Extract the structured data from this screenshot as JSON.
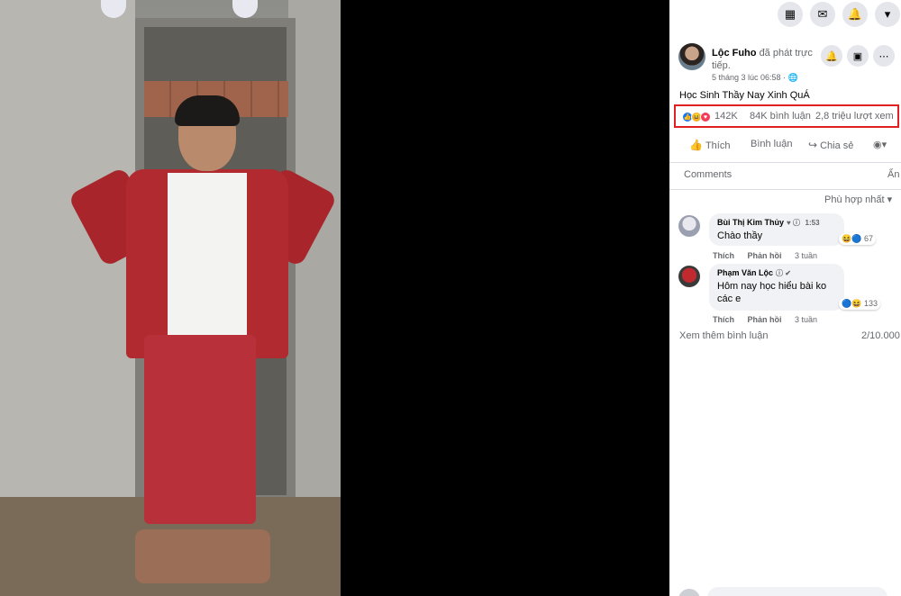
{
  "topbar": {
    "menu_icon": "grid-icon",
    "messenger_icon": "messenger-icon",
    "notification_icon": "bell-icon",
    "account_icon": "caret-down-icon"
  },
  "post": {
    "author": "Lộc Fuho",
    "live_text": "đã phát trực tiếp.",
    "time": "5 tháng 3 lúc 06:58 ·",
    "caption": "Học Sinh Thầy Nay Xinh QuÁ",
    "reactions_count": "142K",
    "comments_count": "84K bình luận",
    "views_count": "2,8 triệu lượt xem",
    "reaction_colors": {
      "like": "#1877f2",
      "haha": "#f7b125",
      "love": "#f33e58"
    },
    "highlight_color": "#e02020"
  },
  "actions": {
    "like": "Thích",
    "comment": "Bình luận",
    "share": "Chia sẻ"
  },
  "comments_section": {
    "tab_comments": "Comments",
    "tab_hide": "Ẩn",
    "sort": "Phù hợp nhất",
    "items": [
      {
        "name": "Bùi Thị Kim Thủy",
        "time": "1:53",
        "text": "Chào thầy",
        "reactions": "67",
        "like": "Thích",
        "reply": "Phản hồi",
        "age": "3 tuần"
      },
      {
        "name": "Phạm Văn Lộc",
        "text": "Hôm nay học hiểu bài ko các e",
        "reactions": "133",
        "like": "Thích",
        "reply": "Phản hồi",
        "age": "3 tuần"
      }
    ],
    "see_more": "Xem thêm bình luận",
    "count": "2/10.000"
  }
}
